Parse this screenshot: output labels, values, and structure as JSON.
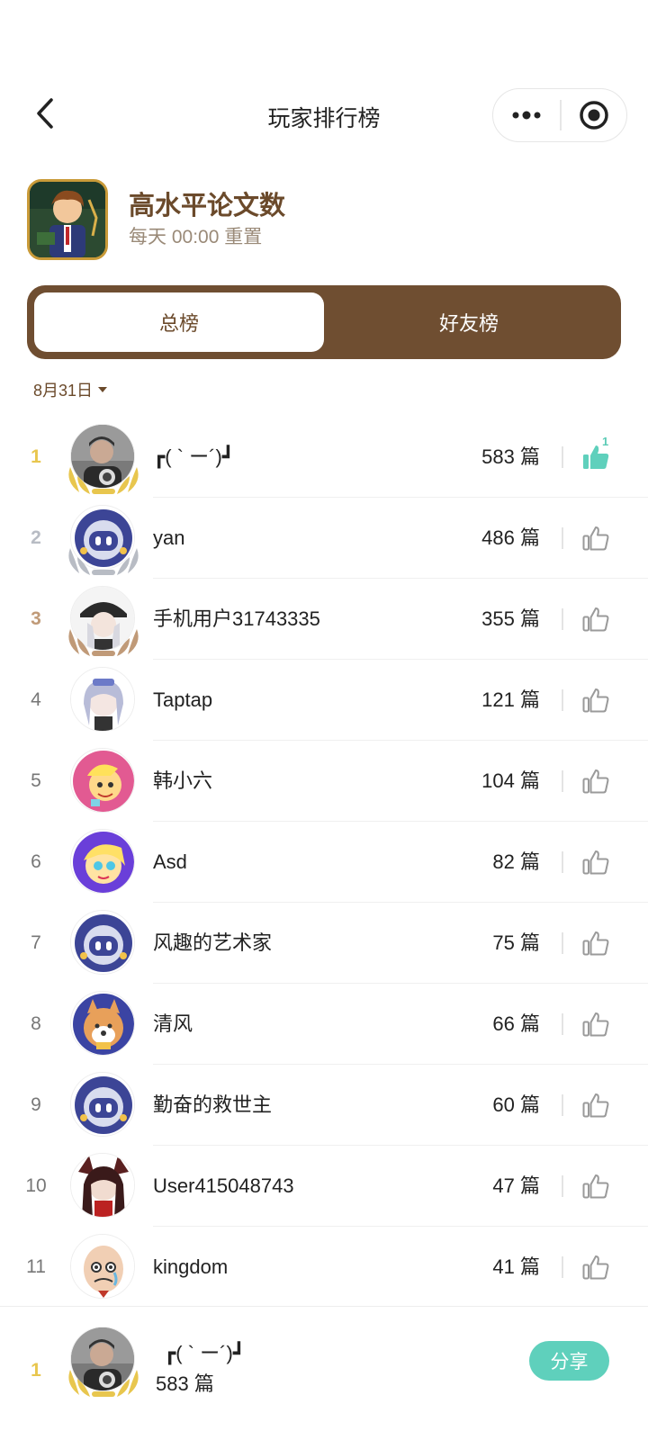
{
  "nav": {
    "title": "玩家排行榜"
  },
  "game": {
    "title": "高水平论文数",
    "subtitle": "每天 00:00 重置"
  },
  "tabs": {
    "overall": "总榜",
    "friends": "好友榜"
  },
  "date_filter": "8月31日",
  "unit": "篇",
  "colors": {
    "brown": "#6f4e31",
    "accent": "#5fd0bc",
    "gold": "#e8c64e",
    "silver": "#b8bcc4",
    "bronze": "#c09a78"
  },
  "rankings": [
    {
      "rank": "1",
      "name": "┏( ` ー´)┛",
      "count": "583 篇",
      "liked": true,
      "like_count": "1",
      "avatar": "portrait-dark"
    },
    {
      "rank": "2",
      "name": "yan",
      "count": "486 篇",
      "liked": false,
      "avatar": "robot-default"
    },
    {
      "rank": "3",
      "name": "手机用户31743335",
      "count": "355 篇",
      "liked": false,
      "avatar": "anime-girl-hat"
    },
    {
      "rank": "4",
      "name": "Taptap",
      "count": "121 篇",
      "liked": false,
      "avatar": "anime-girl-silver"
    },
    {
      "rank": "5",
      "name": "韩小六",
      "count": "104 篇",
      "liked": false,
      "avatar": "cartoon-pink"
    },
    {
      "rank": "6",
      "name": "Asd",
      "count": "82 篇",
      "liked": false,
      "avatar": "cartoon-purple"
    },
    {
      "rank": "7",
      "name": "风趣的艺术家",
      "count": "75 篇",
      "liked": false,
      "avatar": "robot-default"
    },
    {
      "rank": "8",
      "name": "清风",
      "count": "66 篇",
      "liked": false,
      "avatar": "shiba-dog"
    },
    {
      "rank": "9",
      "name": "勤奋的救世主",
      "count": "60 篇",
      "liked": false,
      "avatar": "robot-default"
    },
    {
      "rank": "10",
      "name": "User415048743",
      "count": "47 篇",
      "liked": false,
      "avatar": "fox-girl"
    },
    {
      "rank": "11",
      "name": "kingdom",
      "count": "41 篇",
      "liked": false,
      "avatar": "cartoon-bald-man"
    }
  ],
  "me": {
    "rank": "1",
    "name": "┏( ` ー´)┛",
    "count": "583 篇",
    "avatar": "portrait-dark"
  },
  "share_label": "分享"
}
